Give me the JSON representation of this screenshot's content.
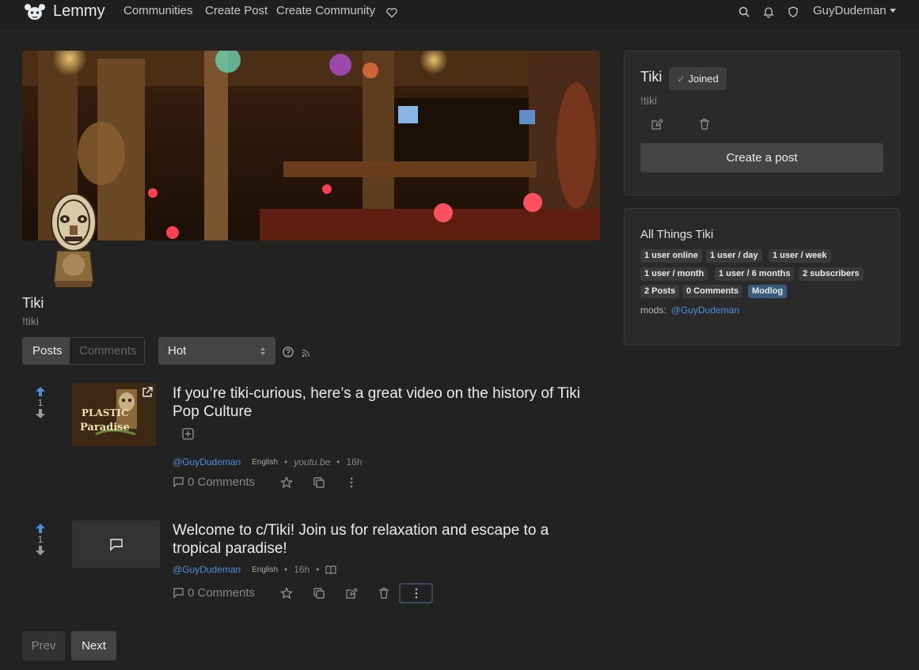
{
  "nav": {
    "brand": "Lemmy",
    "links": [
      "Communities",
      "Create Post",
      "Create Community"
    ],
    "username": "GuyDudeman",
    "icons": [
      "heart-icon",
      "search-icon",
      "bell-icon",
      "shield-icon"
    ]
  },
  "community": {
    "title": "Tiki",
    "handle": "!tiki"
  },
  "tabs": [
    "Posts",
    "Comments"
  ],
  "sort": {
    "selected": "Hot"
  },
  "posts": [
    {
      "votes": "1",
      "title": "If you’re tiki-curious, here’s a great video on the history of Tiki Pop Culture",
      "thumb_text_1": "PLASTIC",
      "thumb_text_2": "Paradise",
      "author": "@GuyDudeman",
      "language": "English",
      "domain": "youtu.be",
      "age": "16h",
      "comments": "0 Comments"
    },
    {
      "votes": "1",
      "title": "Welcome to c/Tiki! Join us for relaxation and escape to a tropical paradise!",
      "author": "@GuyDudeman",
      "language": "English",
      "age": "16h",
      "comments": "0 Comments"
    }
  ],
  "pagination": {
    "prev": "Prev",
    "next": "Next"
  },
  "sidebar": {
    "title": "Tiki",
    "joined_label": "Joined",
    "handle": "!tiki",
    "create_post": "Create a post",
    "description": "All Things Tiki",
    "badges": [
      "1 user online",
      "1 user / day",
      "1 user / week",
      "1 user / month",
      "1 user / 6 months",
      "2 subscribers",
      "2 Posts",
      "0 Comments",
      "Modlog"
    ],
    "mods_label": "mods:",
    "mods_user": "@GuyDudeman"
  },
  "colors": {
    "background": "#222222",
    "navbar": "#1f1f1f",
    "card": "#2a2a2a",
    "link": "#4d8fd6",
    "upvote": "#4d8fd6",
    "modlog_badge": "#375a7f"
  }
}
